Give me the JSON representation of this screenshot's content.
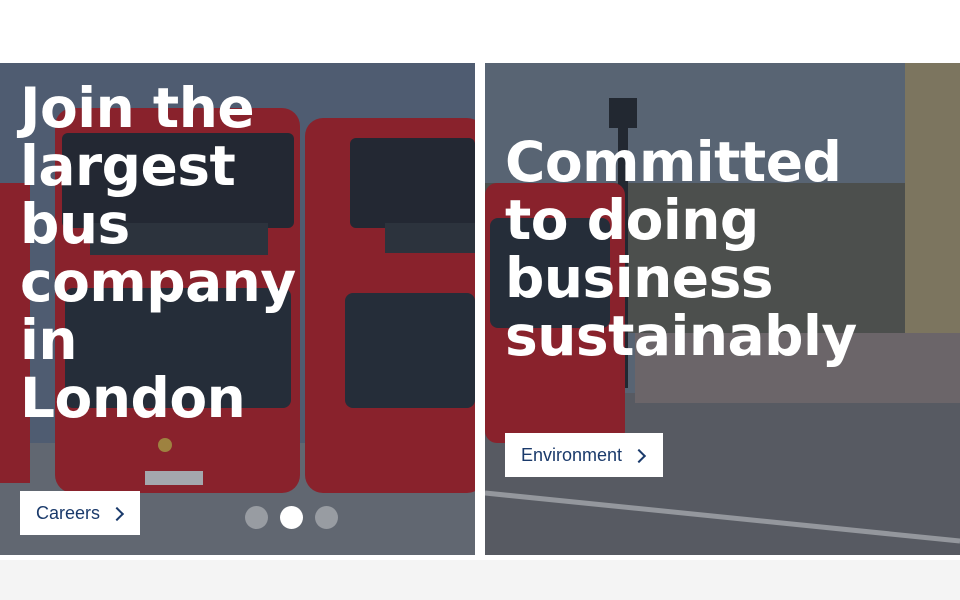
{
  "cards": {
    "left": {
      "headline": "Join the largest bus company in London",
      "cta_label": "Careers",
      "cta_icon": "chevron-right-icon"
    },
    "right": {
      "headline": "Committed to doing business sustainably",
      "cta_label": "Environment",
      "cta_icon": "chevron-right-icon"
    }
  },
  "carousel": {
    "dot_count": 3,
    "active_index": 1
  },
  "colors": {
    "bus_red": "#d42a2a",
    "cta_text": "#1a3a6b",
    "headline_text": "#ffffff"
  }
}
